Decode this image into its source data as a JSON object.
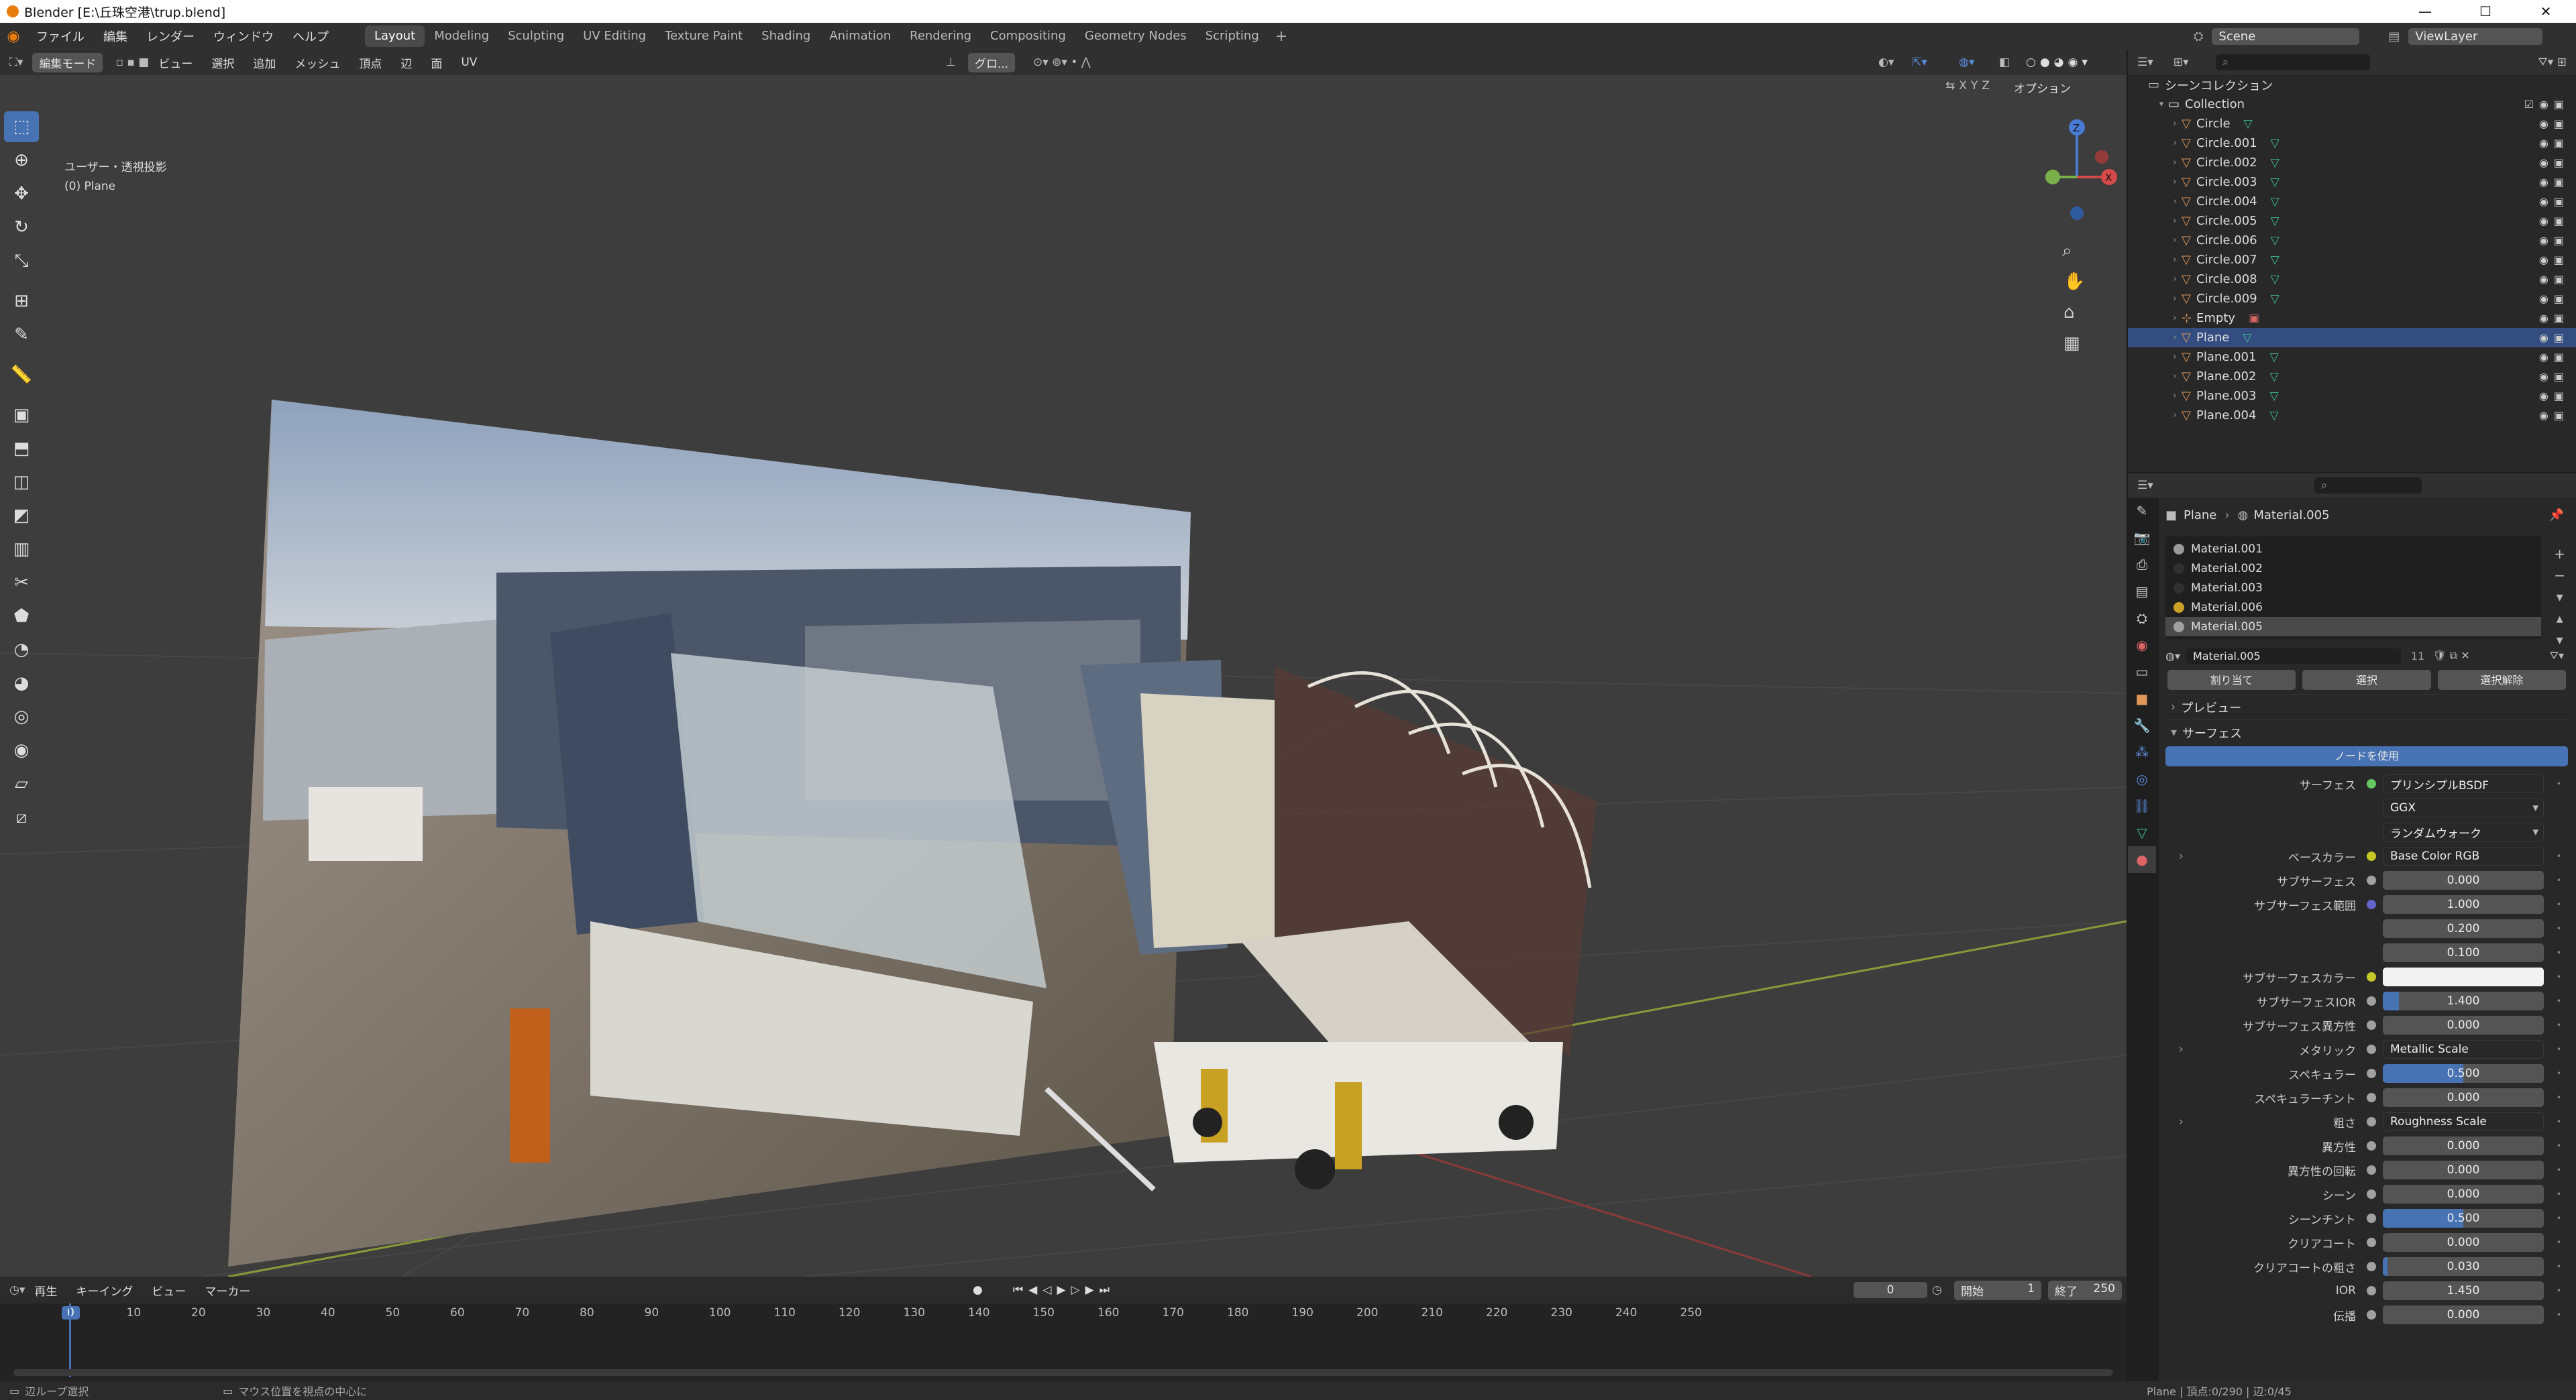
{
  "window": {
    "title": "Blender [E:\\丘珠空港\\trup.blend]",
    "min": "—",
    "max": "☐",
    "close": "✕"
  },
  "menus": [
    "ファイル",
    "編集",
    "レンダー",
    "ウィンドウ",
    "ヘルプ"
  ],
  "workspaces": [
    "Layout",
    "Modeling",
    "Sculpting",
    "UV Editing",
    "Texture Paint",
    "Shading",
    "Animation",
    "Rendering",
    "Compositing",
    "Geometry Nodes",
    "Scripting"
  ],
  "active_workspace": "Layout",
  "scene": "Scene",
  "view_layer": "ViewLayer",
  "viewport_header": {
    "mode": "編集モード",
    "menus": [
      "ビュー",
      "選択",
      "追加",
      "メッシュ",
      "頂点",
      "辺",
      "面",
      "UV"
    ],
    "transform": "グロ...",
    "options": "オプション",
    "axes": [
      "X",
      "Y",
      "Z"
    ]
  },
  "viewport": {
    "projection": "ユーザー・透視投影",
    "object": "(0) Plane"
  },
  "tools": [
    "select-box",
    "cursor",
    "move",
    "rotate",
    "scale",
    "transform",
    "annotate",
    "measure",
    "add-cube",
    "extrude",
    "inset",
    "bevel",
    "loop-cut",
    "knife",
    "poly-build",
    "spin",
    "smooth",
    "shrink",
    "push-pull",
    "shear",
    "rip"
  ],
  "outliner": {
    "root": "シーンコレクション",
    "collection": "Collection",
    "objects": [
      {
        "name": "Circle",
        "type": "mesh"
      },
      {
        "name": "Circle.001",
        "type": "mesh"
      },
      {
        "name": "Circle.002",
        "type": "mesh"
      },
      {
        "name": "Circle.003",
        "type": "mesh"
      },
      {
        "name": "Circle.004",
        "type": "mesh"
      },
      {
        "name": "Circle.005",
        "type": "mesh"
      },
      {
        "name": "Circle.006",
        "type": "mesh"
      },
      {
        "name": "Circle.007",
        "type": "mesh"
      },
      {
        "name": "Circle.008",
        "type": "mesh"
      },
      {
        "name": "Circle.009",
        "type": "mesh"
      },
      {
        "name": "Empty",
        "type": "empty"
      },
      {
        "name": "Plane",
        "type": "mesh",
        "selected": true
      },
      {
        "name": "Plane.001",
        "type": "mesh"
      },
      {
        "name": "Plane.002",
        "type": "mesh"
      },
      {
        "name": "Plane.003",
        "type": "mesh"
      },
      {
        "name": "Plane.004",
        "type": "mesh"
      }
    ]
  },
  "properties": {
    "breadcrumb": [
      "Plane",
      "Material.005"
    ],
    "materials": [
      {
        "name": "Material.001",
        "color": "#9a9a9a"
      },
      {
        "name": "Material.002",
        "color": "#303030"
      },
      {
        "name": "Material.003",
        "color": "#303030"
      },
      {
        "name": "Material.006",
        "color": "#c9a227"
      },
      {
        "name": "Material.005",
        "color": "#a0a0a0",
        "selected": true
      }
    ],
    "slot": {
      "name": "Material.005",
      "users": "11"
    },
    "actions": [
      "割り当て",
      "選択",
      "選択解除"
    ],
    "panels": {
      "preview": "プレビュー",
      "surface": "サーフェス",
      "use_nodes": "ノードを使用"
    },
    "rows": [
      {
        "label": "サーフェス",
        "kind": "socket",
        "value": "プリンシプルBSDF",
        "dot": "#63c763"
      },
      {
        "label": "",
        "kind": "dropdown",
        "value": "GGX"
      },
      {
        "label": "",
        "kind": "dropdown",
        "value": "ランダムウォーク"
      },
      {
        "label": "ベースカラー",
        "kind": "socket",
        "value": "Base Color RGB",
        "dot": "#c7c729",
        "expand": true
      },
      {
        "label": "サブサーフェス",
        "kind": "num",
        "value": "0.000",
        "dot": "#a1a1a1"
      },
      {
        "label": "サブサーフェス範囲",
        "kind": "num",
        "value": "1.000",
        "dot": "#6363c7"
      },
      {
        "label": "",
        "kind": "num",
        "value": "0.200"
      },
      {
        "label": "",
        "kind": "num",
        "value": "0.100"
      },
      {
        "label": "サブサーフェスカラー",
        "kind": "color",
        "value": "",
        "dot": "#c7c729"
      },
      {
        "label": "サブサーフェスIOR",
        "kind": "num",
        "value": "1.400",
        "dot": "#a1a1a1",
        "fill": 0.1
      },
      {
        "label": "サブサーフェス異方性",
        "kind": "num",
        "value": "0.000",
        "dot": "#a1a1a1"
      },
      {
        "label": "メタリック",
        "kind": "socket",
        "value": "Metallic Scale",
        "dot": "#a1a1a1",
        "expand": true
      },
      {
        "label": "スペキュラー",
        "kind": "num",
        "value": "0.500",
        "dot": "#a1a1a1",
        "fill": 0.5
      },
      {
        "label": "スペキュラーチント",
        "kind": "num",
        "value": "0.000",
        "dot": "#a1a1a1"
      },
      {
        "label": "粗さ",
        "kind": "socket",
        "value": "Roughness Scale",
        "dot": "#a1a1a1",
        "expand": true
      },
      {
        "label": "異方性",
        "kind": "num",
        "value": "0.000",
        "dot": "#a1a1a1"
      },
      {
        "label": "異方性の回転",
        "kind": "num",
        "value": "0.000",
        "dot": "#a1a1a1"
      },
      {
        "label": "シーン",
        "kind": "num",
        "value": "0.000",
        "dot": "#a1a1a1"
      },
      {
        "label": "シーンチント",
        "kind": "num",
        "value": "0.500",
        "dot": "#a1a1a1",
        "fill": 0.5
      },
      {
        "label": "クリアコート",
        "kind": "num",
        "value": "0.000",
        "dot": "#a1a1a1"
      },
      {
        "label": "クリアコートの粗さ",
        "kind": "num",
        "value": "0.030",
        "dot": "#a1a1a1",
        "fill": 0.03
      },
      {
        "label": "IOR",
        "kind": "num",
        "value": "1.450",
        "dot": "#a1a1a1"
      },
      {
        "label": "伝播",
        "kind": "num",
        "value": "0.000",
        "dot": "#a1a1a1"
      }
    ]
  },
  "timeline": {
    "menus": [
      "再生",
      "キーイング",
      "ビュー",
      "マーカー"
    ],
    "current": "0",
    "start_label": "開始",
    "start": "1",
    "end_label": "終了",
    "end": "250",
    "ticks": [
      "0",
      "10",
      "20",
      "30",
      "40",
      "50",
      "60",
      "70",
      "80",
      "90",
      "100",
      "110",
      "120",
      "130",
      "140",
      "150",
      "160",
      "170",
      "180",
      "190",
      "200",
      "210",
      "220",
      "230",
      "240",
      "250"
    ]
  },
  "status": {
    "left": "辺ループ選択",
    "middle": "マウス位置を視点の中心に",
    "right": "Plane | 頂点:0/290 | 辺:0/45"
  }
}
